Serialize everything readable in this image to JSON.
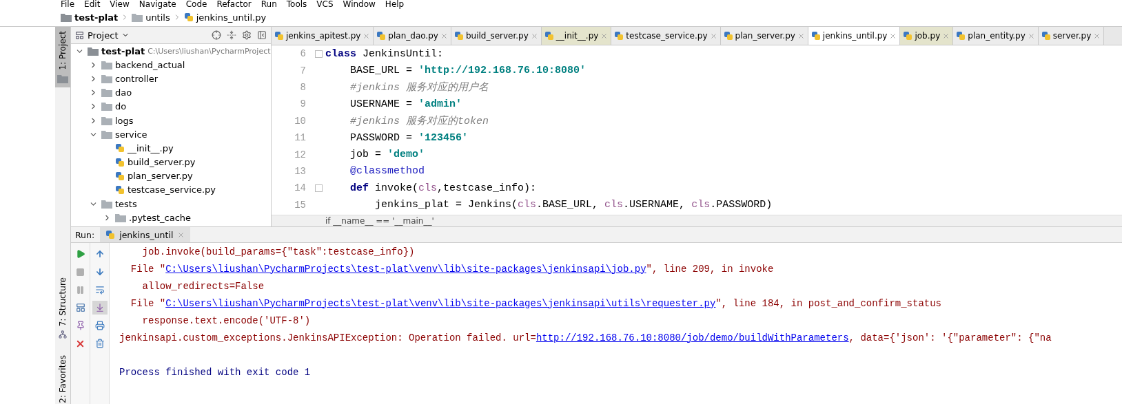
{
  "menu": [
    "File",
    "Edit",
    "View",
    "Navigate",
    "Code",
    "Refactor",
    "Run",
    "Tools",
    "VCS",
    "Window",
    "Help"
  ],
  "breadcrumb": [
    {
      "label": "test-plat",
      "kind": "project"
    },
    {
      "label": "untils",
      "kind": "folder"
    },
    {
      "label": "jenkins_until.py",
      "kind": "file"
    }
  ],
  "tool_windows_top": [
    {
      "label": "1: Project",
      "kind": "project",
      "selected": true
    }
  ],
  "tool_windows_bottom": [
    {
      "label": "7: Structure",
      "kind": "structure",
      "selected": false
    },
    {
      "label": "2: Favorites",
      "kind": "favorites",
      "selected": false
    }
  ],
  "project": {
    "title": "Project",
    "tree": [
      {
        "name": "test-plat",
        "path": "C:\\Users\\liushan\\PycharmProject",
        "kind": "folder",
        "expanded": true,
        "children": [
          {
            "name": "backend_actual",
            "kind": "folder",
            "expanded": false
          },
          {
            "name": "controller",
            "kind": "folder",
            "expanded": false
          },
          {
            "name": "dao",
            "kind": "folder",
            "expanded": false
          },
          {
            "name": "do",
            "kind": "folder",
            "expanded": false
          },
          {
            "name": "logs",
            "kind": "folder",
            "expanded": false
          },
          {
            "name": "service",
            "kind": "folder",
            "expanded": true,
            "children": [
              {
                "name": "__init__.py",
                "kind": "file"
              },
              {
                "name": "build_server.py",
                "kind": "file"
              },
              {
                "name": "plan_server.py",
                "kind": "file"
              },
              {
                "name": "testcase_service.py",
                "kind": "file"
              }
            ]
          },
          {
            "name": "tests",
            "kind": "folder",
            "expanded": true,
            "children": [
              {
                "name": ".pytest_cache",
                "kind": "folder",
                "expanded": false
              }
            ]
          }
        ]
      }
    ]
  },
  "editor": {
    "tabs": [
      {
        "label": "jenkins_apitest.py",
        "selected": false,
        "highlighted": false
      },
      {
        "label": "plan_dao.py",
        "selected": false,
        "highlighted": false
      },
      {
        "label": "build_server.py",
        "selected": false,
        "highlighted": false
      },
      {
        "label": "__init__.py",
        "selected": false,
        "highlighted": true
      },
      {
        "label": "testcase_service.py",
        "selected": false,
        "highlighted": false
      },
      {
        "label": "plan_server.py",
        "selected": false,
        "highlighted": false
      },
      {
        "label": "jenkins_until.py",
        "selected": true,
        "highlighted": false
      },
      {
        "label": "job.py",
        "selected": false,
        "highlighted": true
      },
      {
        "label": "plan_entity.py",
        "selected": false,
        "highlighted": false
      },
      {
        "label": "server.py",
        "selected": false,
        "highlighted": false
      }
    ],
    "lines": [
      {
        "number": "6",
        "fold": true,
        "tokens": [
          {
            "kind": "keyword",
            "text": "class"
          },
          {
            "kind": "plain",
            "text": " JenkinsUntil:"
          }
        ]
      },
      {
        "number": "7",
        "tokens": [
          {
            "kind": "plain",
            "text": "    BASE_URL = "
          },
          {
            "kind": "string",
            "text": "'http://192.168.76.10:8080'"
          }
        ]
      },
      {
        "number": "8",
        "tokens": [
          {
            "kind": "comment",
            "text": "    #jenkins 服务对应的用户名"
          }
        ]
      },
      {
        "number": "9",
        "tokens": [
          {
            "kind": "plain",
            "text": "    USERNAME = "
          },
          {
            "kind": "string",
            "text": "'admin'"
          }
        ]
      },
      {
        "number": "10",
        "tokens": [
          {
            "kind": "comment",
            "text": "    #jenkins 服务对应的token"
          }
        ]
      },
      {
        "number": "11",
        "tokens": [
          {
            "kind": "plain",
            "text": "    PASSWORD = "
          },
          {
            "kind": "string",
            "text": "'123456'"
          }
        ]
      },
      {
        "number": "12",
        "tokens": [
          {
            "kind": "plain",
            "text": "    job = "
          },
          {
            "kind": "string",
            "text": "'demo'"
          }
        ]
      },
      {
        "number": "13",
        "tokens": [
          {
            "kind": "decorator",
            "text": "    @classmethod"
          }
        ]
      },
      {
        "number": "14",
        "fold": true,
        "tokens": [
          {
            "kind": "keyword",
            "text": "    def"
          },
          {
            "kind": "plain",
            "text": " invoke("
          },
          {
            "kind": "self",
            "text": "cls"
          },
          {
            "kind": "plain",
            "text": ",testcase_info):"
          }
        ]
      },
      {
        "number": "15",
        "tokens": [
          {
            "kind": "plain",
            "text": "        jenkins_plat = Jenkins("
          },
          {
            "kind": "self",
            "text": "cls"
          },
          {
            "kind": "plain",
            "text": ".BASE_URL, "
          },
          {
            "kind": "self",
            "text": "cls"
          },
          {
            "kind": "plain",
            "text": ".USERNAME, "
          },
          {
            "kind": "self",
            "text": "cls"
          },
          {
            "kind": "plain",
            "text": ".PASSWORD)"
          }
        ]
      }
    ],
    "breadcrumb": "if __name__ == '__main__'"
  },
  "run": {
    "label": "Run:",
    "tab": "jenkins_until",
    "toolbar_left": [
      {
        "kind": "run",
        "disabled": false
      },
      {
        "kind": "stop",
        "disabled": true
      },
      {
        "kind": "pause",
        "disabled": true
      },
      {
        "kind": "layout",
        "disabled": false
      },
      {
        "kind": "pin",
        "disabled": false
      },
      {
        "kind": "close",
        "disabled": false
      }
    ],
    "toolbar_right": [
      {
        "kind": "up",
        "selected": false
      },
      {
        "kind": "down",
        "selected": false
      },
      {
        "kind": "wrap",
        "selected": false
      },
      {
        "kind": "scroll-end",
        "selected": true
      },
      {
        "kind": "print",
        "selected": false
      },
      {
        "kind": "trash",
        "selected": false
      }
    ],
    "console": [
      {
        "tokens": [
          {
            "kind": "error",
            "text": "    job.invoke(build_params={\"task\":testcase_info})"
          }
        ]
      },
      {
        "tokens": [
          {
            "kind": "error",
            "text": "  File \""
          },
          {
            "kind": "link",
            "text": "C:\\Users\\liushan\\PycharmProjects\\test-plat\\venv\\lib\\site-packages\\jenkinsapi\\job.py"
          },
          {
            "kind": "error",
            "text": "\", line 209, in invoke"
          }
        ]
      },
      {
        "tokens": [
          {
            "kind": "error",
            "text": "    allow_redirects=False"
          }
        ]
      },
      {
        "tokens": [
          {
            "kind": "error",
            "text": "  File \""
          },
          {
            "kind": "link",
            "text": "C:\\Users\\liushan\\PycharmProjects\\test-plat\\venv\\lib\\site-packages\\jenkinsapi\\utils\\requester.py"
          },
          {
            "kind": "error",
            "text": "\", line 184, in post_and_confirm_status"
          }
        ]
      },
      {
        "tokens": [
          {
            "kind": "error",
            "text": "    response.text.encode('UTF-8')"
          }
        ]
      },
      {
        "tokens": [
          {
            "kind": "error",
            "text": "jenkinsapi.custom_exceptions.JenkinsAPIException: Operation failed. url="
          },
          {
            "kind": "link",
            "text": "http://192.168.76.10:8080/job/demo/buildWithParameters"
          },
          {
            "kind": "error",
            "text": ", data={'json': '{\"parameter\": {\"na"
          }
        ]
      },
      {
        "spaced": true,
        "tokens": [
          {
            "kind": "info",
            "text": "Process finished with exit code 1"
          }
        ]
      }
    ]
  }
}
